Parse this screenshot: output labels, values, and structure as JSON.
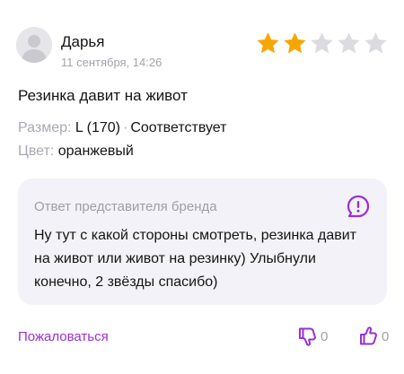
{
  "review": {
    "author": "Дарья",
    "date": "11 сентября, 14:26",
    "rating": 2,
    "rating_max": 5,
    "text": "Резинка давит на живот",
    "size_label": "Размер:",
    "size_value": "L (170)",
    "fit_value": "Соответствует",
    "color_label": "Цвет:",
    "color_value": "оранжевый"
  },
  "brand_reply": {
    "title": "Ответ представителя бренда",
    "text": "Ну тут с какой стороны смотреть, резинка давит на живот или живот на резинку) Улыбнули конечно, 2 звёзды спасибо)",
    "icon": "alert-bubble-icon"
  },
  "actions": {
    "complain_label": "Пожаловаться",
    "dislike_count": "0",
    "like_count": "0",
    "dislike_icon": "thumbs-down-icon",
    "like_icon": "thumbs-up-icon"
  },
  "colors": {
    "accent": "#9a2fd0",
    "star_filled": "#f7a600",
    "star_empty": "#dcdce0",
    "muted_text": "#a3a3ab",
    "reply_background": "#f3f2f8"
  }
}
